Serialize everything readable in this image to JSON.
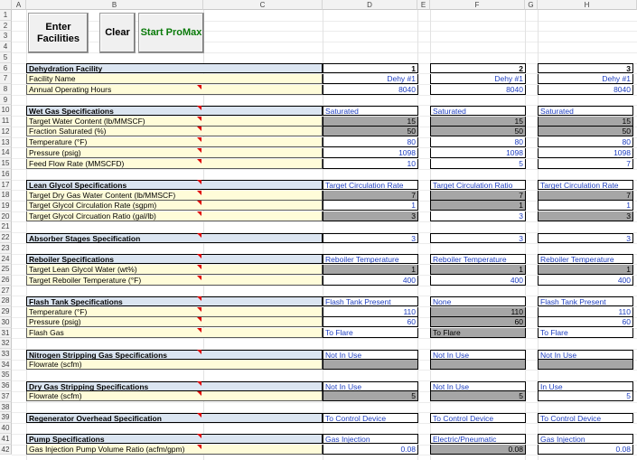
{
  "buttons": {
    "enter": "Enter\nFacilities",
    "clear": "Clear",
    "start": "Start ProMax",
    "start_color": "#0a7a0a"
  },
  "columns": [
    "A",
    "B",
    "C",
    "D",
    "E",
    "F",
    "G",
    "H"
  ],
  "rows": [
    "1",
    "2",
    "3",
    "4",
    "5",
    "6",
    "7",
    "8",
    "9",
    "10",
    "11",
    "12",
    "13",
    "14",
    "15",
    "16",
    "17",
    "18",
    "19",
    "20",
    "21",
    "22",
    "23",
    "24",
    "25",
    "26",
    "27",
    "28",
    "29",
    "30",
    "31",
    "32",
    "33",
    "34",
    "35",
    "36",
    "37",
    "38",
    "39",
    "40",
    "41",
    "42"
  ],
  "colors": {
    "label_bg": "#fffcd9",
    "header_bg": "#dbe5f1",
    "gray_cell": "#a6a6a6",
    "value_text": "#2040c0",
    "comment_marker": "#e00000"
  },
  "sheet": [
    {
      "row": 6,
      "label": "Dehydration Facility",
      "type": "hdr",
      "vals": [
        {
          "t": "1",
          "s": "hdrnum"
        },
        {
          "t": "2",
          "s": "hdrnum"
        },
        {
          "t": "3",
          "s": "hdrnum"
        }
      ]
    },
    {
      "row": 7,
      "label": "Facility Name",
      "type": "lbl",
      "vals": [
        {
          "t": "Dehy #1"
        },
        {
          "t": "Dehy #1"
        },
        {
          "t": "Dehy #1"
        }
      ]
    },
    {
      "row": 8,
      "label": "Annual Operating Hours",
      "type": "lbl",
      "tri": true,
      "vals": [
        {
          "t": "8040"
        },
        {
          "t": "8040"
        },
        {
          "t": "8040"
        }
      ]
    },
    {
      "row": 10,
      "label": "Wet Gas Specifications",
      "type": "hdr",
      "tri": true,
      "vals": [
        {
          "t": "Saturated",
          "s": "left"
        },
        {
          "t": "Saturated",
          "s": "left"
        },
        {
          "t": "Saturated",
          "s": "left"
        }
      ]
    },
    {
      "row": 11,
      "label": "Target Water Content (lb/MMSCF)",
      "type": "lbl",
      "tri": true,
      "vals": [
        {
          "t": "15",
          "s": "gray"
        },
        {
          "t": "15",
          "s": "gray"
        },
        {
          "t": "15",
          "s": "gray"
        }
      ]
    },
    {
      "row": 12,
      "label": "Fraction Saturated (%)",
      "type": "lbl",
      "tri": true,
      "vals": [
        {
          "t": "50",
          "s": "gray"
        },
        {
          "t": "50",
          "s": "gray"
        },
        {
          "t": "50",
          "s": "gray"
        }
      ]
    },
    {
      "row": 13,
      "label": "Temperature (°F)",
      "type": "lbl",
      "tri": true,
      "vals": [
        {
          "t": "80"
        },
        {
          "t": "80"
        },
        {
          "t": "80"
        }
      ]
    },
    {
      "row": 14,
      "label": "Pressure (psig)",
      "type": "lbl",
      "tri": true,
      "vals": [
        {
          "t": "1098"
        },
        {
          "t": "1098"
        },
        {
          "t": "1098"
        }
      ]
    },
    {
      "row": 15,
      "label": "Feed Flow Rate (MMSCFD)",
      "type": "lbl",
      "tri": true,
      "vals": [
        {
          "t": "10"
        },
        {
          "t": "5"
        },
        {
          "t": "7"
        }
      ]
    },
    {
      "row": 17,
      "label": "Lean Glycol Specifications",
      "type": "hdr",
      "tri": true,
      "vals": [
        {
          "t": "Target Circulation Rate",
          "s": "left"
        },
        {
          "t": "Target Circulation Ratio",
          "s": "left"
        },
        {
          "t": "Target Circulation Rate",
          "s": "left"
        }
      ]
    },
    {
      "row": 18,
      "label": "Target Dry Gas Water Content (lb/MMSCF)",
      "type": "lbl",
      "tri": true,
      "vals": [
        {
          "t": "7",
          "s": "gray"
        },
        {
          "t": "7",
          "s": "gray"
        },
        {
          "t": "7",
          "s": "gray"
        }
      ]
    },
    {
      "row": 19,
      "label": "Target Glycol Circulation Rate (sgpm)",
      "type": "lbl",
      "tri": true,
      "vals": [
        {
          "t": "1"
        },
        {
          "t": "1",
          "s": "gray"
        },
        {
          "t": "1"
        }
      ]
    },
    {
      "row": 20,
      "label": "Target Glycol Circuation Ratio (gal/lb)",
      "type": "lbl",
      "tri": true,
      "vals": [
        {
          "t": "3",
          "s": "gray"
        },
        {
          "t": "3"
        },
        {
          "t": "3",
          "s": "gray"
        }
      ]
    },
    {
      "row": 22,
      "label": "Absorber Stages Specification",
      "type": "hdr",
      "tri": true,
      "vals": [
        {
          "t": "3"
        },
        {
          "t": "3"
        },
        {
          "t": "3"
        }
      ]
    },
    {
      "row": 24,
      "label": "Reboiler Specifications",
      "type": "hdr",
      "tri": true,
      "vals": [
        {
          "t": "Reboiler Temperature",
          "s": "left"
        },
        {
          "t": "Reboiler Temperature",
          "s": "left"
        },
        {
          "t": "Reboiler Temperature",
          "s": "left"
        }
      ]
    },
    {
      "row": 25,
      "label": "Target Lean Glycol Water (wt%)",
      "type": "lbl",
      "tri": true,
      "vals": [
        {
          "t": "1",
          "s": "gray"
        },
        {
          "t": "1",
          "s": "gray"
        },
        {
          "t": "1",
          "s": "gray"
        }
      ]
    },
    {
      "row": 26,
      "label": "Target Reboiler Temperature (°F)",
      "type": "lbl",
      "tri": true,
      "vals": [
        {
          "t": "400"
        },
        {
          "t": "400"
        },
        {
          "t": "400"
        }
      ]
    },
    {
      "row": 28,
      "label": "Flash Tank Specifications",
      "type": "hdr",
      "tri": true,
      "vals": [
        {
          "t": "Flash Tank Present",
          "s": "left"
        },
        {
          "t": "None",
          "s": "left"
        },
        {
          "t": "Flash Tank Present",
          "s": "left"
        }
      ]
    },
    {
      "row": 29,
      "label": "Temperature (°F)",
      "type": "lbl",
      "tri": true,
      "vals": [
        {
          "t": "110"
        },
        {
          "t": "110",
          "s": "gray"
        },
        {
          "t": "110"
        }
      ]
    },
    {
      "row": 30,
      "label": "Pressure (psig)",
      "type": "lbl",
      "tri": true,
      "vals": [
        {
          "t": "60"
        },
        {
          "t": "60",
          "s": "gray"
        },
        {
          "t": "60"
        }
      ]
    },
    {
      "row": 31,
      "label": "Flash Gas",
      "type": "lbl",
      "tri": true,
      "vals": [
        {
          "t": "To Flare",
          "s": "left"
        },
        {
          "t": "To Flare",
          "s": "left gray"
        },
        {
          "t": "To Flare",
          "s": "left"
        }
      ]
    },
    {
      "row": 33,
      "label": "Nitrogen Stripping Gas Specifications",
      "type": "hdr",
      "tri": true,
      "vals": [
        {
          "t": "Not In Use",
          "s": "left"
        },
        {
          "t": "Not In Use",
          "s": "left"
        },
        {
          "t": "Not In Use",
          "s": "left"
        }
      ]
    },
    {
      "row": 34,
      "label": "Flowrate (scfm)",
      "type": "lbl",
      "vals": [
        {
          "t": "",
          "s": "gray"
        },
        {
          "t": "",
          "s": "gray"
        },
        {
          "t": "",
          "s": "gray"
        }
      ]
    },
    {
      "row": 36,
      "label": "Dry Gas Stripping Specifications",
      "type": "hdr",
      "tri": true,
      "vals": [
        {
          "t": "Not In Use",
          "s": "left"
        },
        {
          "t": "Not In Use",
          "s": "left"
        },
        {
          "t": "In Use",
          "s": "left"
        }
      ]
    },
    {
      "row": 37,
      "label": "Flowrate (scfm)",
      "type": "lbl",
      "tri": true,
      "vals": [
        {
          "t": "5",
          "s": "gray"
        },
        {
          "t": "5",
          "s": "gray"
        },
        {
          "t": "5"
        }
      ]
    },
    {
      "row": 39,
      "label": "Regenerator Overhead Specification",
      "type": "hdr",
      "tri": true,
      "vals": [
        {
          "t": "To Control Device",
          "s": "left"
        },
        {
          "t": "To Control Device",
          "s": "left"
        },
        {
          "t": "To Control Device",
          "s": "left"
        }
      ]
    },
    {
      "row": 41,
      "label": "Pump Specifications",
      "type": "hdr",
      "tri": true,
      "vals": [
        {
          "t": "Gas Injection",
          "s": "left"
        },
        {
          "t": "Electric/Pneumatic",
          "s": "left"
        },
        {
          "t": "Gas Injection",
          "s": "left"
        }
      ]
    },
    {
      "row": 42,
      "label": "Gas Injection Pump Volume Ratio (acfm/gpm)",
      "type": "lbl",
      "tri": true,
      "vals": [
        {
          "t": "0.08"
        },
        {
          "t": "0.08",
          "s": "gray"
        },
        {
          "t": "0.08"
        }
      ]
    }
  ]
}
